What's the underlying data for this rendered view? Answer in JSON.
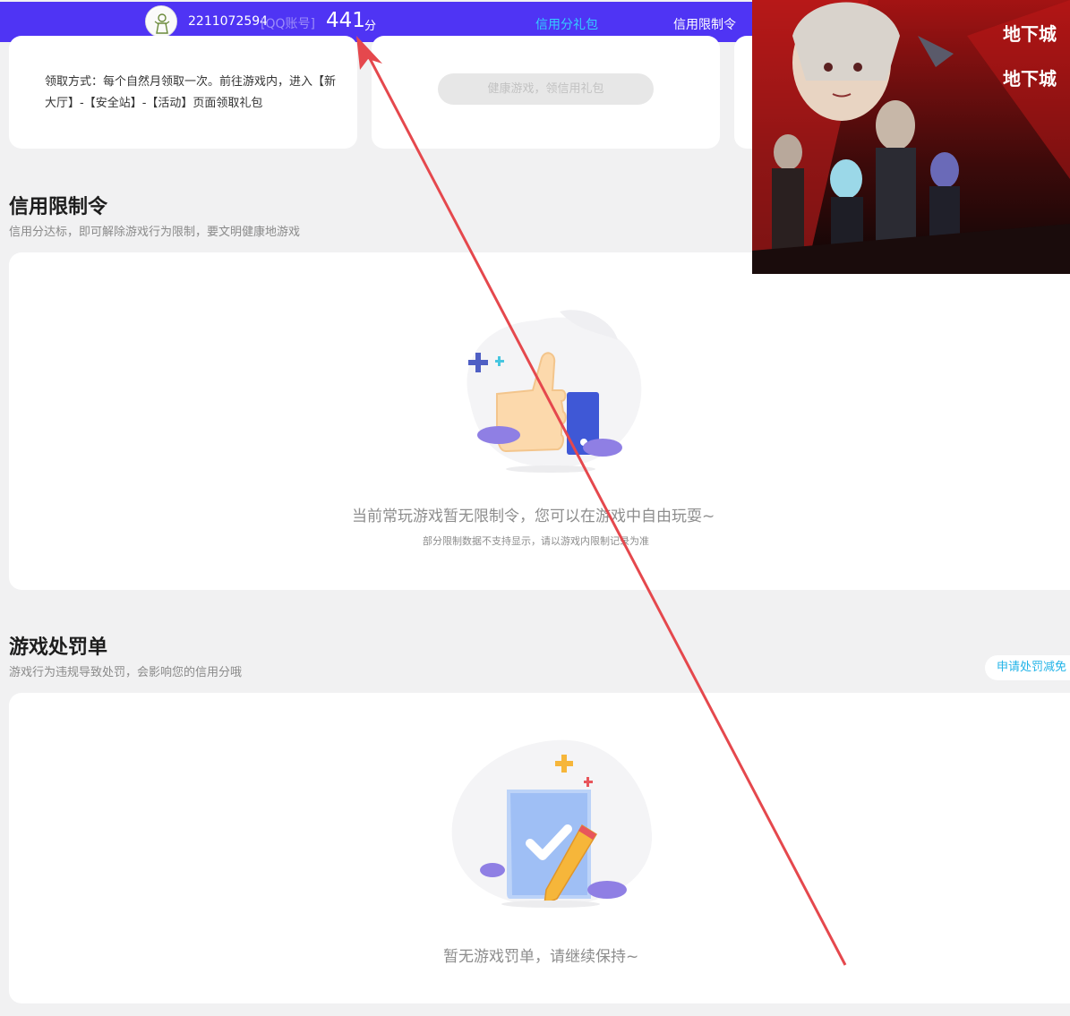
{
  "header": {
    "account_id": "2211072594",
    "account_type": "[QQ账号]",
    "score": "441",
    "score_unit": "分",
    "tabs": [
      {
        "label": "信用分礼包",
        "active": true
      },
      {
        "label": "信用限制令",
        "active": false
      }
    ]
  },
  "gift_section": {
    "claim_method": "领取方式：每个自然月领取一次。前往游戏内，进入【新大厅】-【安全站】-【活动】页面领取礼包",
    "claim_button": "健康游戏，领信用礼包"
  },
  "restriction_section": {
    "title": "信用限制令",
    "subtitle": "信用分达标，即可解除游戏行为限制，要文明健康地游戏",
    "empty_message": "当前常玩游戏暂无限制令，您可以在游戏中自由玩耍~",
    "empty_note": "部分限制数据不支持显示，请以游戏内限制记录为准"
  },
  "penalty_section": {
    "title": "游戏处罚单",
    "subtitle": "游戏行为违规导致处罚，会影响您的信用分哦",
    "appeal_button": "申请处罚减免",
    "empty_message": "暂无游戏罚单，请继续保持~"
  },
  "colors": {
    "header_bg": "#4f34f4",
    "active_tab": "#33cfff",
    "annotation_arrow": "#e5484d"
  },
  "icons": [
    "thumbs-up-illustration",
    "checklist-pencil-illustration",
    "game-poster"
  ]
}
